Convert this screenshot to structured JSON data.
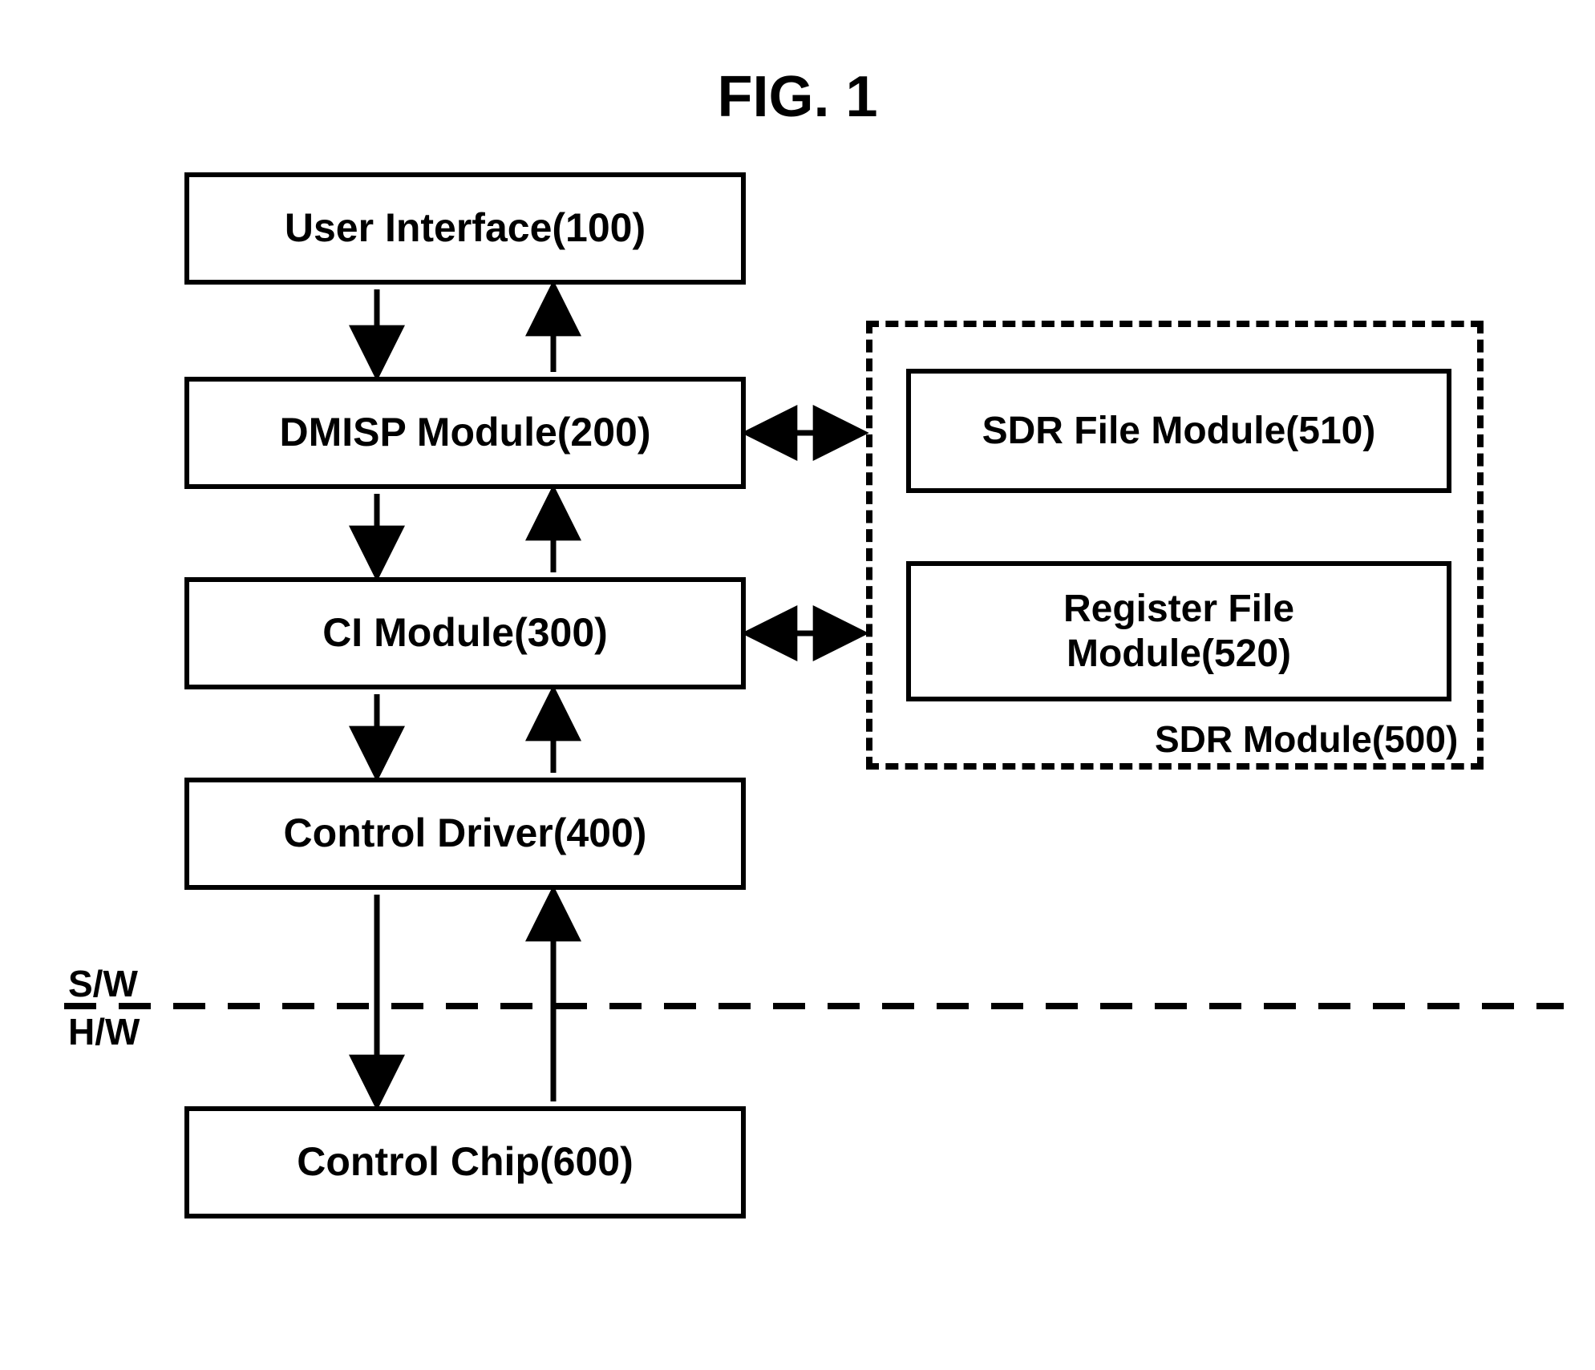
{
  "title": "FIG. 1",
  "blocks": {
    "ui": "User Interface(100)",
    "dmisp": "DMISP Module(200)",
    "ci": "CI Module(300)",
    "driver": "Control Driver(400)",
    "chip": "Control Chip(600)",
    "sdr": "SDR Module(500)",
    "sdr_file": "SDR File Module(510)",
    "reg_file": "Register File\nModule(520)"
  },
  "labels": {
    "sw": "S/W",
    "hw": "H/W"
  }
}
